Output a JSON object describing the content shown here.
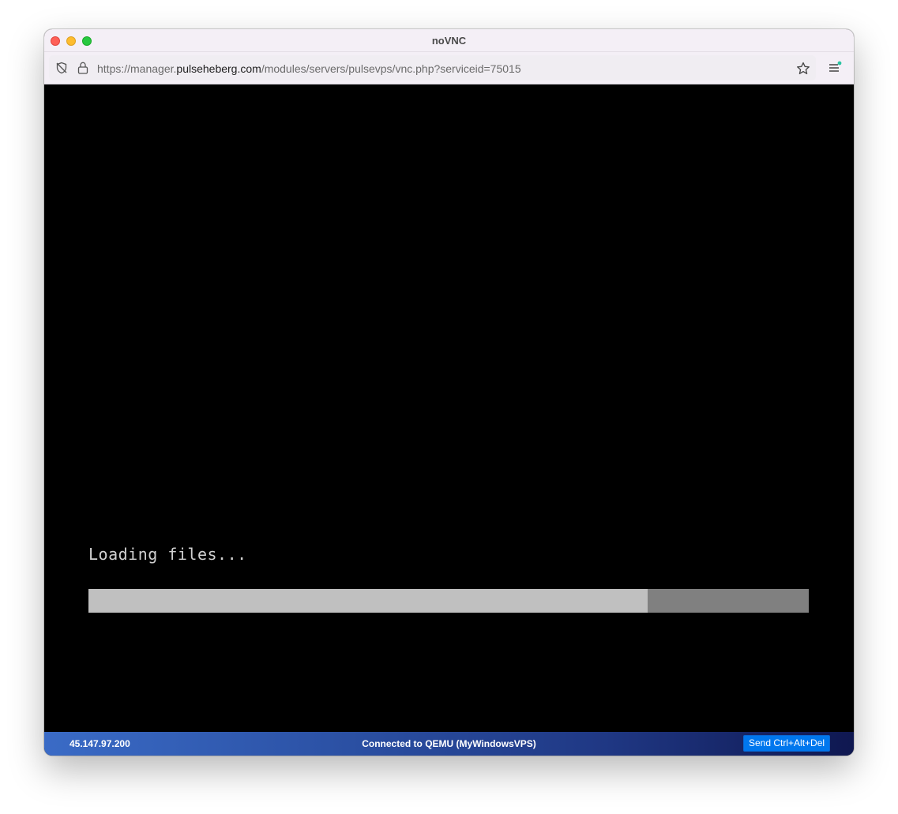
{
  "window": {
    "title": "noVNC"
  },
  "browser": {
    "url_prefix": "https://manager.",
    "url_domain": "pulseheberg.com",
    "url_path": "/modules/servers/pulsevps/vnc.php?serviceid=75015",
    "icons": [
      "tracking-protection-icon",
      "lock-icon",
      "bookmark-star-icon",
      "menu-icon"
    ]
  },
  "vnc": {
    "loading_text": "Loading files...",
    "progress": 0.776,
    "progress_fill_color": "#c0c0c0",
    "progress_track_color": "#808080"
  },
  "statusbar": {
    "ip": "45.147.97.200",
    "connection": "Connected to QEMU (MyWindowsVPS)",
    "send_cad_label": "Send Ctrl+Alt+Del",
    "button_color": "#0077ee"
  }
}
